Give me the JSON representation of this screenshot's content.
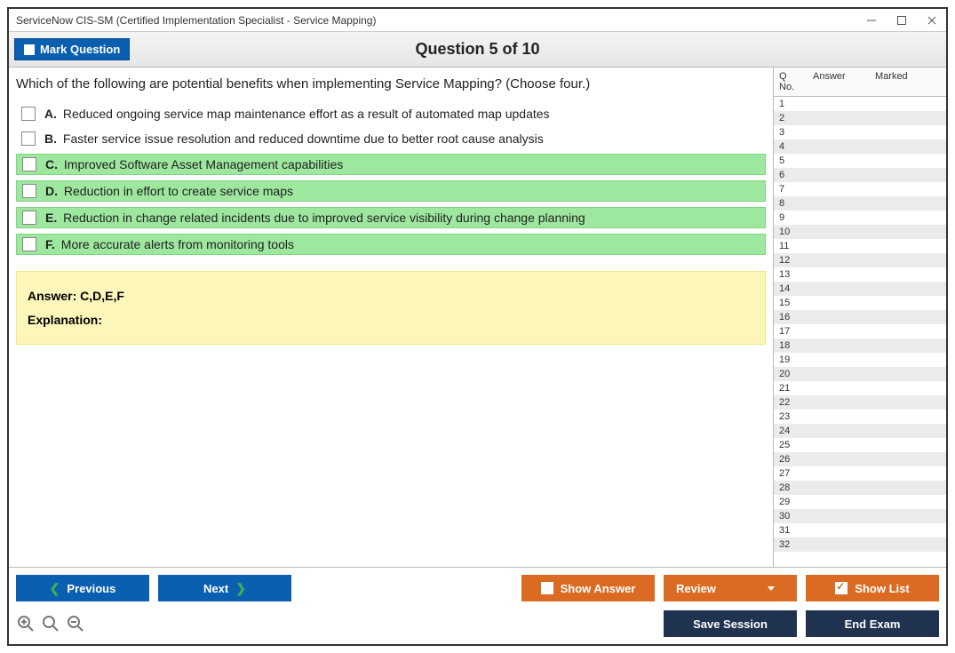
{
  "window": {
    "title": "ServiceNow CIS-SM (Certified Implementation Specialist - Service Mapping)"
  },
  "header": {
    "mark_label": "Mark Question",
    "title": "Question 5 of 10"
  },
  "question": {
    "text": "Which of the following are potential benefits when implementing Service Mapping? (Choose four.)",
    "options": [
      {
        "letter": "A.",
        "text": "Reduced ongoing service map maintenance effort as a result of automated map updates",
        "correct": false
      },
      {
        "letter": "B.",
        "text": "Faster service issue resolution and reduced downtime due to better root cause analysis",
        "correct": false
      },
      {
        "letter": "C.",
        "text": "Improved Software Asset Management capabilities",
        "correct": true
      },
      {
        "letter": "D.",
        "text": "Reduction in effort to create service maps",
        "correct": true
      },
      {
        "letter": "E.",
        "text": "Reduction in change related incidents due to improved service visibility during change planning",
        "correct": true
      },
      {
        "letter": "F.",
        "text": "More accurate alerts from monitoring tools",
        "correct": true
      }
    ],
    "answer_label": "Answer:",
    "answer_value": "C,D,E,F",
    "explanation_label": "Explanation:"
  },
  "side": {
    "col_qno": "Q No.",
    "col_answer": "Answer",
    "col_marked": "Marked",
    "rows": [
      "1",
      "2",
      "3",
      "4",
      "5",
      "6",
      "7",
      "8",
      "9",
      "10",
      "11",
      "12",
      "13",
      "14",
      "15",
      "16",
      "17",
      "18",
      "19",
      "20",
      "21",
      "22",
      "23",
      "24",
      "25",
      "26",
      "27",
      "28",
      "29",
      "30",
      "31",
      "32"
    ]
  },
  "footer": {
    "previous": "Previous",
    "next": "Next",
    "show_answer": "Show Answer",
    "review": "Review",
    "show_list": "Show List",
    "save_session": "Save Session",
    "end_exam": "End Exam"
  }
}
